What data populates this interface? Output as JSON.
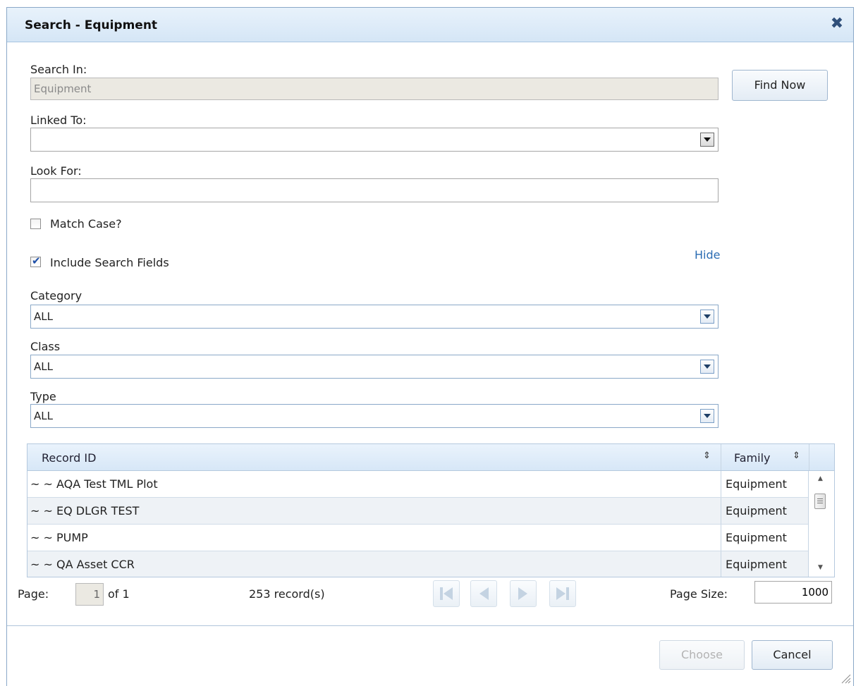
{
  "dialog": {
    "title": "Search - Equipment"
  },
  "form": {
    "search_in_label": "Search In:",
    "search_in_value": "Equipment",
    "linked_to_label": "Linked To:",
    "linked_to_value": "",
    "look_for_label": "Look For:",
    "look_for_value": "",
    "match_case_label": "Match Case?",
    "match_case_checked": false,
    "include_fields_label": "Include Search Fields",
    "include_fields_checked": true,
    "hide_link": "Hide",
    "category_label": "Category",
    "category_value": "ALL",
    "class_label": "Class",
    "class_value": "ALL",
    "type_label": "Type",
    "type_value": "ALL",
    "find_now_label": "Find Now"
  },
  "grid": {
    "columns": [
      "Record ID",
      "Family"
    ],
    "rows": [
      {
        "record_id": "~ ~ AQA Test TML Plot",
        "family": "Equipment"
      },
      {
        "record_id": "~ ~ EQ DLGR TEST",
        "family": "Equipment"
      },
      {
        "record_id": "~ ~ PUMP",
        "family": "Equipment"
      },
      {
        "record_id": "~ ~ QA Asset CCR",
        "family": "Equipment"
      }
    ]
  },
  "pager": {
    "page_label": "Page:",
    "page_value": "1",
    "of_text": "of 1",
    "records_text": "253 record(s)",
    "page_size_label": "Page Size:",
    "page_size_value": "1000"
  },
  "footer": {
    "choose_label": "Choose",
    "cancel_label": "Cancel"
  },
  "colors": {
    "accent": "#2b6cb3",
    "header_bg": "#d5e6f6"
  }
}
